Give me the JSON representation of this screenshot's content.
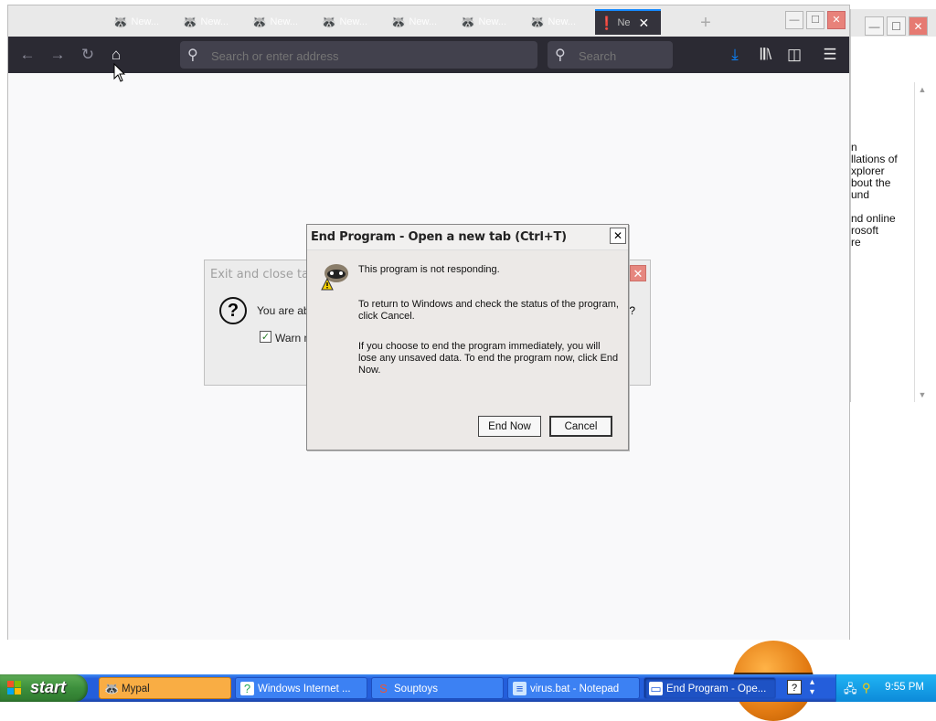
{
  "background_window": {
    "controls": {
      "minimize": "—",
      "maximize": "☐",
      "close": "✕"
    },
    "partial_text": "n\nllations of\nxplorer\nbout the\nund\n\nnd online\nrosoft\nre"
  },
  "browser": {
    "tabs": [
      {
        "label": "New..."
      },
      {
        "label": "New..."
      },
      {
        "label": "New..."
      },
      {
        "label": "New..."
      },
      {
        "label": "New..."
      },
      {
        "label": "New..."
      },
      {
        "label": "New..."
      }
    ],
    "active_tab": {
      "label": "Ne"
    },
    "address_placeholder": "Search or enter address",
    "search_placeholder": "Search"
  },
  "dialog_back": {
    "title": "Exit and close tabs?",
    "message": "You are abo",
    "trailing": "?",
    "checkbox_label": "Warn m",
    "checkbox_checked": true
  },
  "dialog": {
    "title": "End Program - Open a new tab (Ctrl+T)",
    "line1": "This program is not responding.",
    "line2": "To return to Windows and check the status of the program, click Cancel.",
    "line3": "If you choose to end the program immediately, you will lose any unsaved data. To end the program now, click End Now.",
    "end_now": "End Now",
    "cancel": "Cancel"
  },
  "taskbar": {
    "start_label": "start",
    "tasks": [
      {
        "label": "Mypal"
      },
      {
        "label": "Windows Internet ..."
      },
      {
        "label": "Souptoys"
      },
      {
        "label": "virus.bat - Notepad"
      },
      {
        "label": "End Program - Ope..."
      }
    ],
    "clock": "9:55 PM"
  }
}
